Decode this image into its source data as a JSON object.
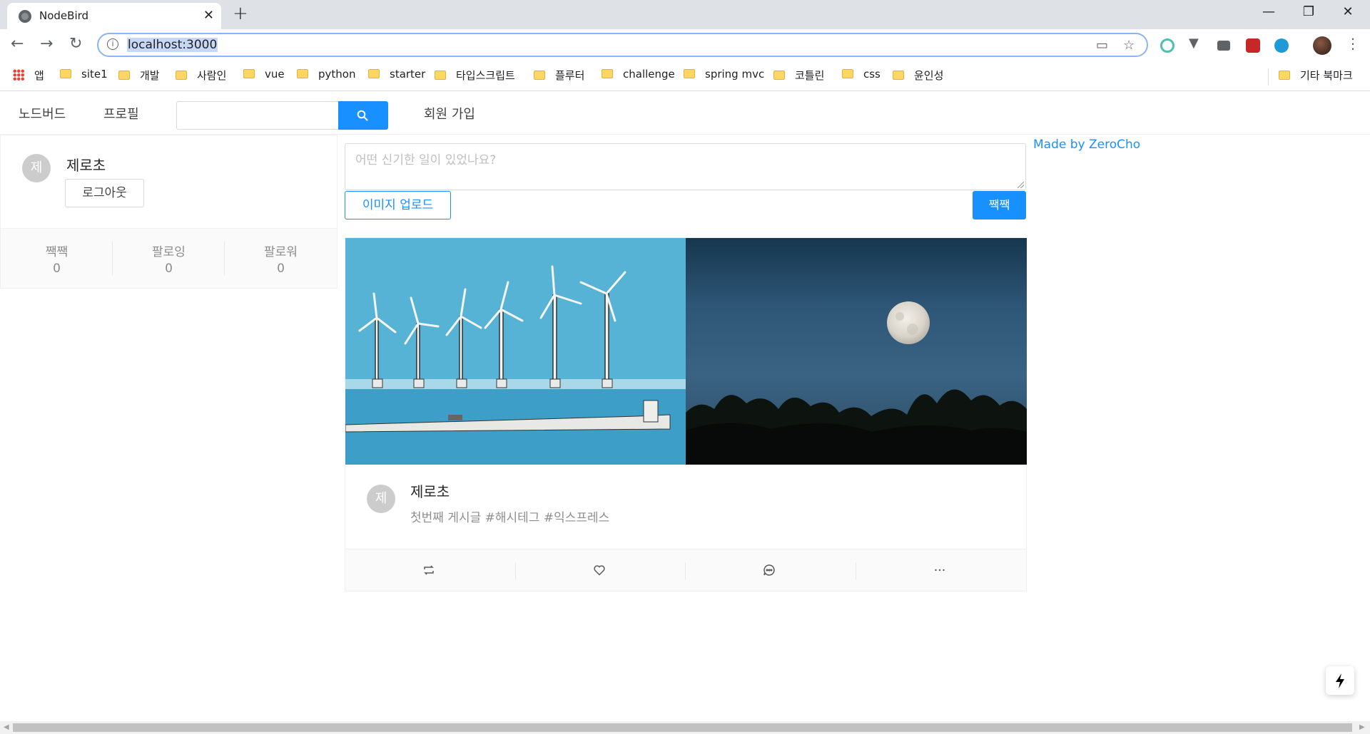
{
  "browser": {
    "tab_title": "NodeBird",
    "new_tab": "+",
    "tab_close": "✕",
    "url": "localhost:3000",
    "bookmarks": [
      "앱",
      "site1",
      "개발",
      "사람인",
      "vue",
      "python",
      "starter",
      "타입스크립트",
      "플루터",
      "challenge",
      "spring mvc",
      "코틀린",
      "css",
      "윤인성"
    ],
    "other_bookmarks": "기타 북마크"
  },
  "nav": {
    "home": "노드버드",
    "profile": "프로필",
    "search_placeholder": "",
    "signup": "회원 가입"
  },
  "profile_card": {
    "avatar_letter": "제",
    "nickname": "제로초",
    "logout_label": "로그아웃",
    "stats": [
      {
        "label": "짹짹",
        "value": "0"
      },
      {
        "label": "팔로잉",
        "value": "0"
      },
      {
        "label": "팔로워",
        "value": "0"
      }
    ]
  },
  "post_form": {
    "placeholder": "어떤 신기한 일이 있었나요?",
    "upload_label": "이미지 업로드",
    "submit_label": "짹짹"
  },
  "credit": "Made by ZeroCho",
  "post": {
    "avatar_letter": "제",
    "author": "제로초",
    "content": "첫번째 게시글 #해시테그 #익스프레스",
    "actions": [
      "retweet-icon",
      "heart-icon",
      "message-icon",
      "ellipsis-icon"
    ]
  },
  "colors": {
    "primary": "#1890ff",
    "avatar_bg": "#cccccc"
  }
}
